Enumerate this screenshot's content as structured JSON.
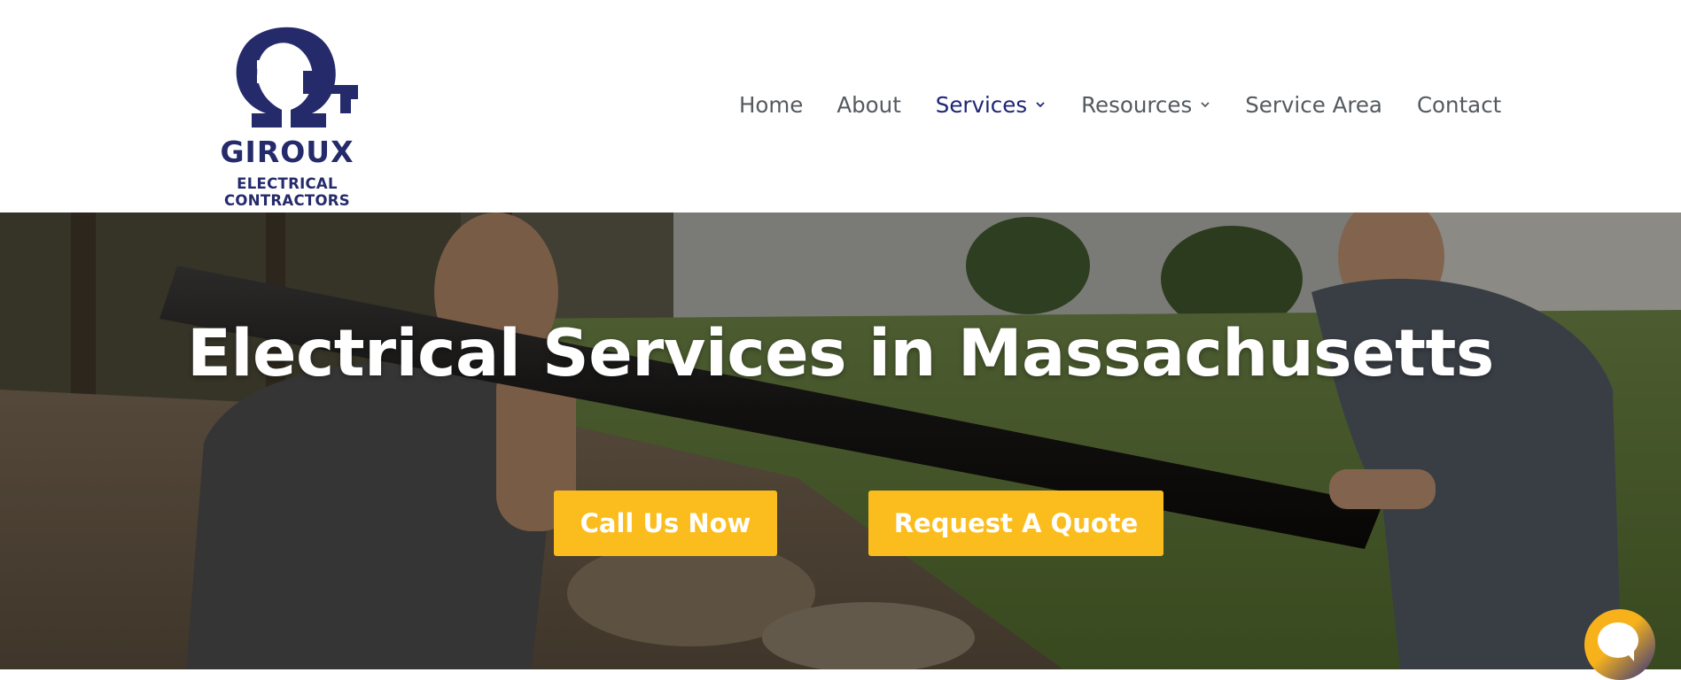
{
  "brand": {
    "name": "GIROUX",
    "tagline": "ELECTRICAL CONTRACTORS",
    "logo_icon": "eg-omega-monogram",
    "primary_color": "#252a6b"
  },
  "nav": {
    "items": [
      {
        "label": "Home",
        "has_dropdown": false,
        "active": false
      },
      {
        "label": "About",
        "has_dropdown": false,
        "active": false
      },
      {
        "label": "Services",
        "has_dropdown": true,
        "active": true
      },
      {
        "label": "Resources",
        "has_dropdown": true,
        "active": false
      },
      {
        "label": "Service Area",
        "has_dropdown": false,
        "active": false
      },
      {
        "label": "Contact",
        "has_dropdown": false,
        "active": false
      }
    ],
    "text_color": "#555a5f",
    "active_color": "#1f2574"
  },
  "hero": {
    "title": "Electrical Services in Massachusetts",
    "buttons": {
      "call": "Call Us Now",
      "quote": "Request A Quote"
    },
    "button_color": "#fbbd1d",
    "background": "photo-two-electricians-carrying-conduit-in-yard"
  },
  "chat": {
    "icon": "chat-bubble-icon"
  }
}
